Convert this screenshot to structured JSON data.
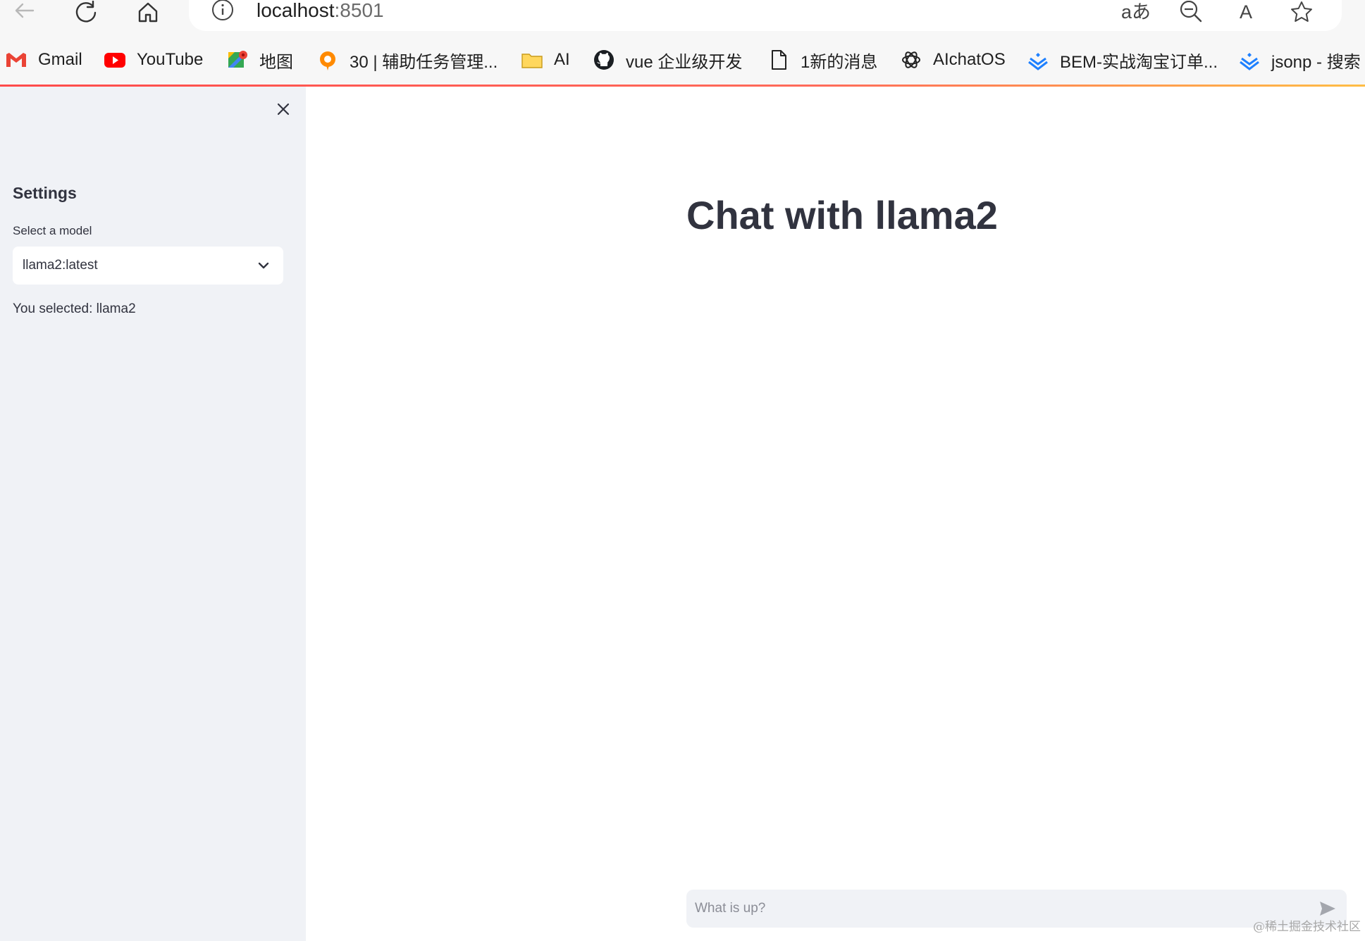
{
  "browser": {
    "url_host": "localhost",
    "url_port": ":8501",
    "translate_glyph": "aあ",
    "read_aloud_glyph": "A",
    "bookmarks": [
      {
        "label": "Gmail",
        "icon": "gmail-icon"
      },
      {
        "label": "YouTube",
        "icon": "youtube-icon"
      },
      {
        "label": "地图",
        "icon": "maps-icon"
      },
      {
        "label": "30 | 辅助任务管理...",
        "icon": "app-icon"
      },
      {
        "label": "AI",
        "icon": "folder-icon"
      },
      {
        "label": "vue 企业级开发",
        "icon": "github-icon"
      },
      {
        "label": "1新的消息",
        "icon": "document-icon"
      },
      {
        "label": "AIchatOS",
        "icon": "openai-icon"
      },
      {
        "label": "BEM-实战淘宝订单...",
        "icon": "juejin-icon"
      },
      {
        "label": "jsonp - 搜索",
        "icon": "juejin-icon"
      }
    ]
  },
  "sidebar": {
    "title": "Settings",
    "select_label": "Select a model",
    "select_value": "llama2:latest",
    "selected_text": "You selected: llama2"
  },
  "main": {
    "title": "Chat with llama2",
    "chat_placeholder": "What is up?"
  },
  "watermark": "@稀土掘金技术社区",
  "colors": {
    "sidebar_bg": "#f0f2f6",
    "text": "#31333f",
    "accent_start": "#ff4b4b",
    "accent_end": "#ffbd45"
  }
}
